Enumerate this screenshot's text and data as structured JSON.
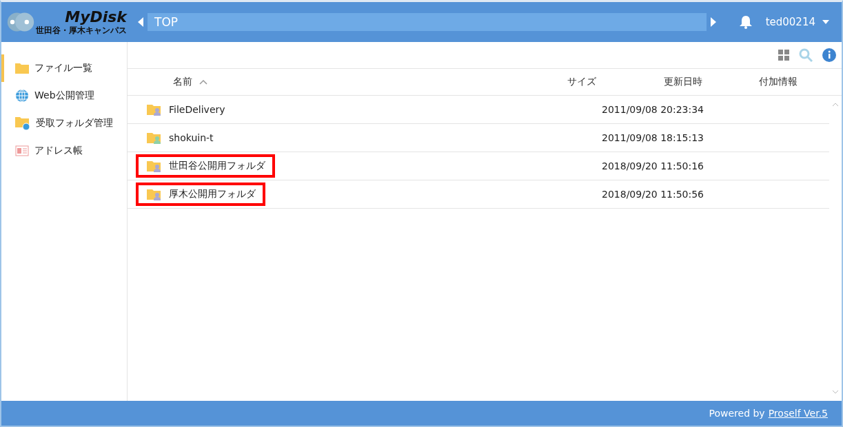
{
  "header": {
    "logo_text": "MyDisk",
    "logo_subtitle": "世田谷・厚木キャンパス",
    "path": "TOP",
    "user": "ted00214"
  },
  "sidebar": {
    "items": [
      {
        "label": "ファイル一覧",
        "kind": "folder",
        "selected": true
      },
      {
        "label": "Web公開管理",
        "kind": "globe",
        "selected": false
      },
      {
        "label": "受取フォルダ管理",
        "kind": "inbox",
        "selected": false
      },
      {
        "label": "アドレス帳",
        "kind": "contacts",
        "selected": false
      }
    ]
  },
  "table": {
    "columns": [
      {
        "label": "名前",
        "sorted": true
      },
      {
        "label": "サイズ",
        "sorted": false
      },
      {
        "label": "更新日時",
        "sorted": false
      },
      {
        "label": "付加情報",
        "sorted": false
      }
    ],
    "rows": [
      {
        "name": "FileDelivery",
        "modified": "2011/09/08 20:23:34",
        "color": "#a9a9d6",
        "highlighted": false
      },
      {
        "name": "shokuin-t",
        "modified": "2011/09/08 18:15:13",
        "color": "#8fd1a8",
        "highlighted": false
      },
      {
        "name": "世田谷公開用フォルダ",
        "modified": "2018/09/20 11:50:16",
        "color": "#a9a9d6",
        "highlighted": true
      },
      {
        "name": "厚木公開用フォルダ",
        "modified": "2018/09/20 11:50:56",
        "color": "#a9a9d6",
        "highlighted": true
      }
    ]
  },
  "footer": {
    "text": "Powered by",
    "link": "Proself Ver.5"
  }
}
